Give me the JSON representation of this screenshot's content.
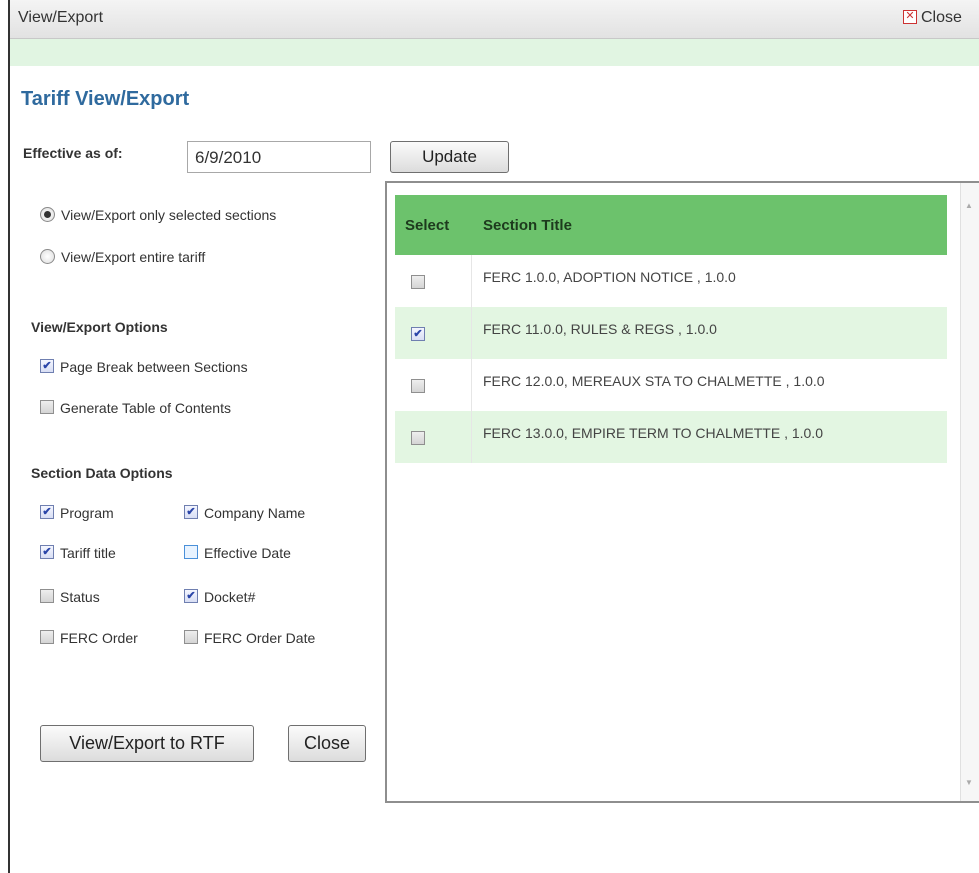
{
  "titlebar": {
    "title": "View/Export",
    "close_label": "Close",
    "close_icon": "x-box-icon"
  },
  "heading": "Tariff View/Export",
  "effective": {
    "label": "Effective as of:",
    "value": "6/9/2010",
    "update_label": "Update"
  },
  "scope": [
    {
      "label": "View/Export only selected sections",
      "selected": true
    },
    {
      "label": "View/Export entire tariff",
      "selected": false
    }
  ],
  "view_options": {
    "title": "View/Export Options",
    "page_break": {
      "label": "Page Break between Sections",
      "checked": true
    },
    "toc": {
      "label": "Generate Table of Contents",
      "checked": false
    }
  },
  "data_options": {
    "title": "Section Data Options",
    "program": {
      "label": "Program",
      "checked": true
    },
    "company_name": {
      "label": "Company Name",
      "checked": true
    },
    "tariff_title": {
      "label": "Tariff title",
      "checked": true
    },
    "effective_date": {
      "label": "Effective Date",
      "checked": false
    },
    "status": {
      "label": "Status",
      "checked": false
    },
    "docket": {
      "label": "Docket#",
      "checked": true
    },
    "ferc_order": {
      "label": "FERC Order",
      "checked": false
    },
    "ferc_order_date": {
      "label": "FERC Order Date",
      "checked": false
    }
  },
  "table": {
    "col_select": "Select",
    "col_title": "Section Title",
    "rows": [
      {
        "title": "FERC 1.0.0, ADOPTION NOTICE , 1.0.0",
        "checked": false
      },
      {
        "title": "FERC 11.0.0, RULES & REGS , 1.0.0",
        "checked": true
      },
      {
        "title": "FERC 12.0.0, MEREAUX STA TO CHALMETTE , 1.0.0",
        "checked": false
      },
      {
        "title": "FERC 13.0.0, EMPIRE TERM TO CHALMETTE , 1.0.0",
        "checked": false
      }
    ]
  },
  "actions": {
    "export_label": "View/Export to RTF",
    "close_label": "Close"
  },
  "colors": {
    "accent": "#2f6a9e",
    "header_green": "#6cc26c",
    "row_green": "#e3f6e2",
    "banner": "#e1f5e2"
  }
}
